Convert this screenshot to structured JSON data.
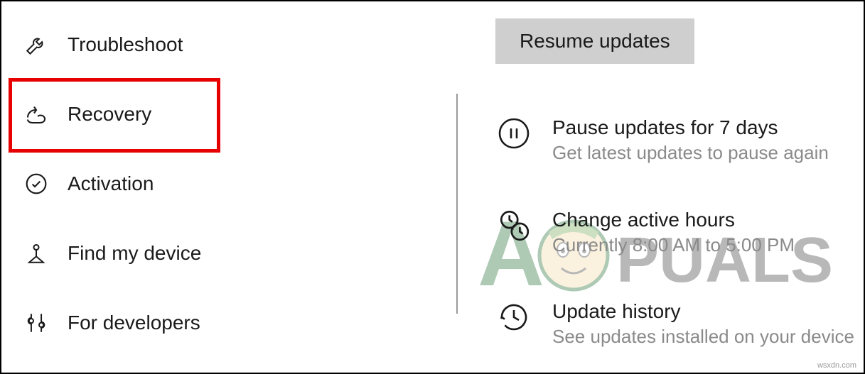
{
  "sidebar": {
    "items": [
      {
        "label": "Troubleshoot",
        "icon": "wrench-icon"
      },
      {
        "label": "Recovery",
        "icon": "recovery-icon"
      },
      {
        "label": "Activation",
        "icon": "check-circle-icon"
      },
      {
        "label": "Find my device",
        "icon": "location-pin-icon"
      },
      {
        "label": "For developers",
        "icon": "developer-tools-icon"
      }
    ]
  },
  "main": {
    "resume_button_label": "Resume updates",
    "options": [
      {
        "title": "Pause updates for 7 days",
        "subtitle": "Get latest updates to pause again",
        "icon": "pause-circle-icon"
      },
      {
        "title": "Change active hours",
        "subtitle": "Currently 8:00 AM to 5:00 PM",
        "icon": "clock-sync-icon"
      },
      {
        "title": "Update history",
        "subtitle": "See updates installed on your device",
        "icon": "history-icon"
      }
    ]
  },
  "watermark": {
    "prefix": "A",
    "suffix": "PUALS"
  },
  "footer": {
    "credit": "wsxdn.com"
  }
}
